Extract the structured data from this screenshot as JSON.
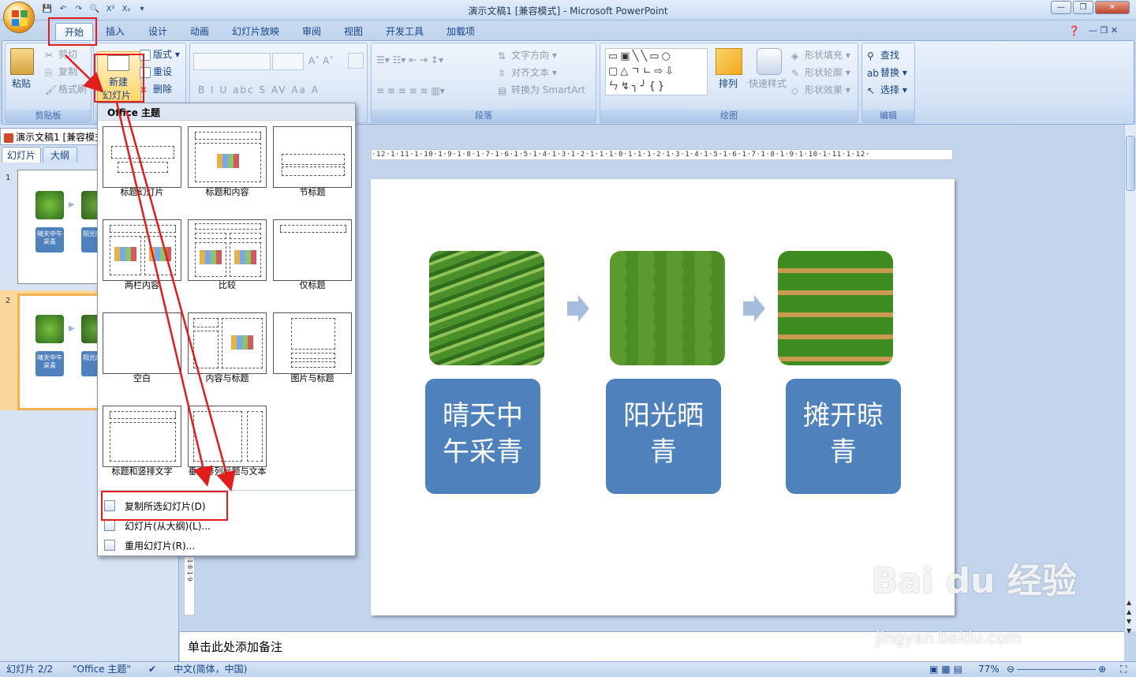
{
  "window": {
    "title": "演示文稿1 [兼容模式] - Microsoft PowerPoint",
    "superscript": "X²",
    "subscript": "X₂"
  },
  "tabs": [
    "开始",
    "插入",
    "设计",
    "动画",
    "幻灯片放映",
    "审阅",
    "视图",
    "开发工具",
    "加载项"
  ],
  "ribbon": {
    "clipboard": {
      "paste": "粘贴",
      "cut": "剪切",
      "copy": "复制",
      "format_painter": "格式刷",
      "label": "剪贴板"
    },
    "slides": {
      "new_slide_line1": "新建",
      "new_slide_line2": "幻灯片",
      "layout": "版式",
      "reset": "重设",
      "delete": "删除"
    },
    "font": {
      "bold": "B",
      "italic": "I",
      "underline": "U",
      "strike": "abc",
      "shadow": "S",
      "spacing": "AV",
      "case": "Aa",
      "color": "A"
    },
    "paragraph": {
      "text_direction": "文字方向",
      "align_text": "对齐文本",
      "smartart": "转换为 SmartArt",
      "label": "段落"
    },
    "drawing": {
      "arrange": "排列",
      "quick_styles": "快速样式",
      "shape_fill": "形状填充",
      "shape_outline": "形状轮廓",
      "shape_effects": "形状效果",
      "label": "绘图"
    },
    "editing": {
      "find": "查找",
      "replace": "替换",
      "select": "选择",
      "label": "编辑"
    }
  },
  "left_pane": {
    "doc_tab": "演示文稿1 [兼容模式]",
    "tab_slides": "幻灯片",
    "tab_outline": "大纲",
    "slide_numbers": [
      "1",
      "2"
    ],
    "thumb_box1": "晴天中午采青",
    "thumb_box2": "阳光晒青"
  },
  "ruler": "·12·1·11·1·10·1·9·1·8·1·7·1·6·1·5·1·4·1·3·1·2·1·1·1·0·1·1·1·2·1·3·1·4·1·5·1·6·1·7·1·8·1·9·1·10·1·11·1·12·",
  "vruler": "·1·8·1·9·",
  "slide": {
    "steps": [
      {
        "text": "晴天中午采青"
      },
      {
        "text": "阳光晒青"
      },
      {
        "text": "摊开晾青"
      }
    ]
  },
  "notes": "单击此处添加备注",
  "status": {
    "slide": "幻灯片 2/2",
    "theme": "\"Office 主题\"",
    "language": "中文(简体，中国)",
    "zoom": "77%"
  },
  "dropdown": {
    "header": "Office 主题",
    "layouts": [
      "标题幻灯片",
      "标题和内容",
      "节标题",
      "两栏内容",
      "比较",
      "仅标题",
      "空白",
      "内容与标题",
      "图片与标题",
      "标题和竖排文字",
      "垂直排列标题与文本"
    ],
    "menu": [
      "复制所选幻灯片(D)",
      "幻灯片(从大纲)(L)...",
      "重用幻灯片(R)..."
    ]
  },
  "watermark": {
    "brand": "Bai du 经验",
    "url": "jingyan.baidu.com"
  },
  "colors": {
    "accent": "#4f81bd",
    "annotation": "#e31c1c",
    "selection": "#f7b24f"
  }
}
